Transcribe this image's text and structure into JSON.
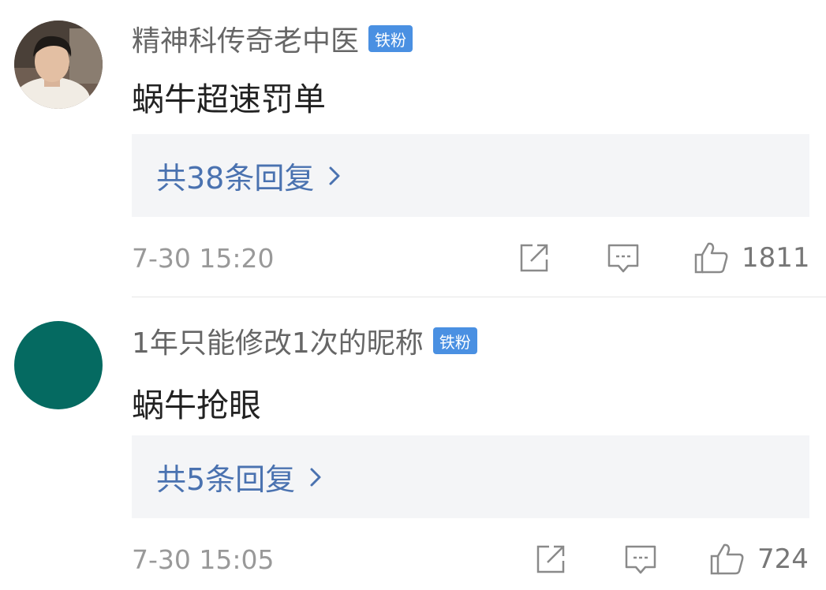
{
  "comments": [
    {
      "username": "精神科传奇老中医",
      "badge": "铁粉",
      "content": "蜗牛超速罚单",
      "replies_label": "共38条回复",
      "time": "7-30 15:20",
      "likes": "1811"
    },
    {
      "username": "1年只能修改1次的昵称",
      "badge": "铁粉",
      "content": "蜗牛抢眼",
      "replies_label": "共5条回复",
      "time": "7-30 15:05",
      "likes": "724"
    }
  ],
  "icons": [
    "share-icon",
    "comment-icon",
    "thumbs-up-icon",
    "chevron-right-icon"
  ],
  "colors": {
    "badge": "#4a90e2",
    "reply_link": "#4a72b0",
    "reply_box": "#f4f5f7",
    "avatar2": "#056a61"
  }
}
